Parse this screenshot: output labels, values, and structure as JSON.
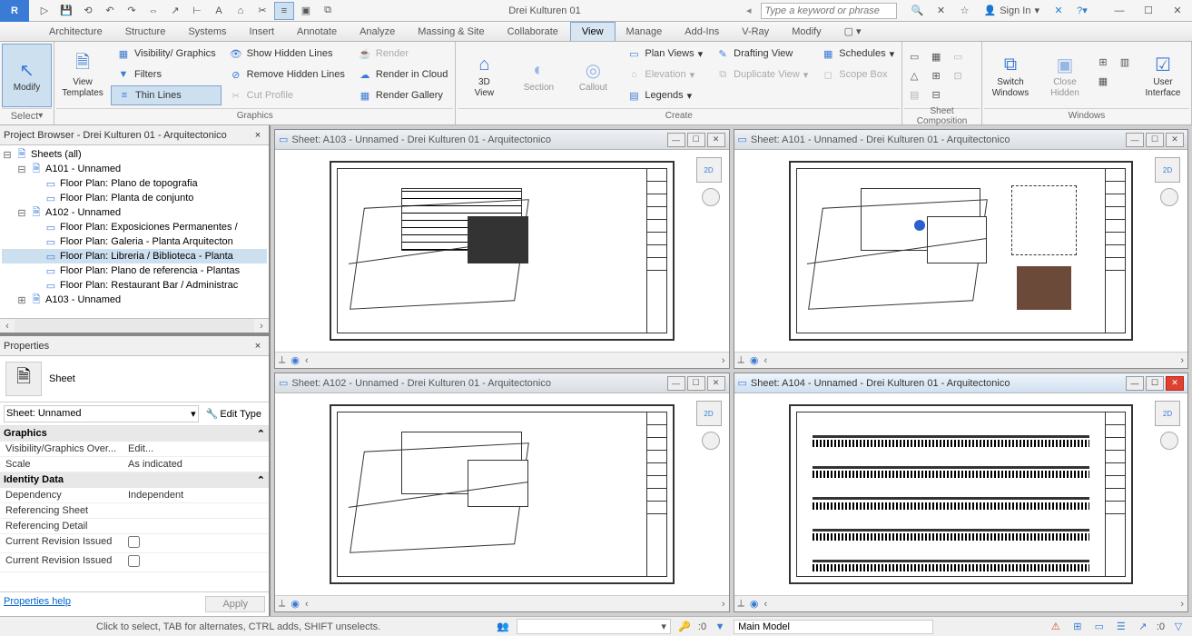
{
  "title": "Drei Kulturen 01",
  "search_placeholder": "Type a keyword or phrase",
  "sign_in": "Sign In",
  "tabs": [
    "Architecture",
    "Structure",
    "Systems",
    "Insert",
    "Annotate",
    "Analyze",
    "Massing & Site",
    "Collaborate",
    "View",
    "Manage",
    "Add-Ins",
    "V-Ray",
    "Modify"
  ],
  "active_tab": "View",
  "ribbon": {
    "select": "Select",
    "modify": "Modify",
    "view_templates": "View\nTemplates",
    "vis_graphics": "Visibility/ Graphics",
    "filters": "Filters",
    "thin_lines": "Thin Lines",
    "show_hidden": "Show Hidden Lines",
    "remove_hidden": "Remove Hidden Lines",
    "cut_profile": "Cut Profile",
    "render": "Render",
    "render_cloud": "Render in Cloud",
    "render_gallery": "Render Gallery",
    "view3d": "3D\nView",
    "section": "Section",
    "callout": "Callout",
    "plan_views": "Plan Views",
    "elevation": "Elevation",
    "drafting_view": "Drafting View",
    "duplicate_view": "Duplicate View",
    "legends": "Legends",
    "schedules": "Schedules",
    "scope_box": "Scope Box",
    "switch_windows": "Switch\nWindows",
    "close_hidden": "Close\nHidden",
    "user_interface": "User\nInterface",
    "panel_graphics": "Graphics",
    "panel_create": "Create",
    "panel_sheetcomp": "Sheet Composition",
    "panel_windows": "Windows"
  },
  "browser": {
    "title": "Project Browser - Drei Kulturen 01 - Arquitectonico",
    "root": "Sheets (all)",
    "sheets": [
      {
        "name": "A101 - Unnamed",
        "plans": [
          "Floor Plan: Plano de topografia",
          "Floor Plan: Planta de conjunto"
        ]
      },
      {
        "name": "A102 - Unnamed",
        "plans": [
          "Floor Plan: Exposiciones Permanentes / ",
          "Floor Plan: Galeria - Planta Arquitecton",
          "Floor Plan: Libreria / Biblioteca - Planta",
          "Floor Plan: Plano de referencia - Plantas",
          "Floor Plan: Restaurant Bar / Administrac"
        ]
      },
      {
        "name": "A103 - Unnamed",
        "plans": []
      }
    ],
    "selected": "Floor Plan: Libreria / Biblioteca - Planta"
  },
  "properties": {
    "title": "Properties",
    "type": "Sheet",
    "selector": "Sheet: Unnamed",
    "edit_type": "Edit Type",
    "groups": [
      {
        "name": "Graphics",
        "rows": [
          {
            "k": "Visibility/Graphics Over...",
            "v": "Edit..."
          },
          {
            "k": "Scale",
            "v": "As indicated"
          }
        ]
      },
      {
        "name": "Identity Data",
        "rows": [
          {
            "k": "Dependency",
            "v": "Independent"
          },
          {
            "k": "Referencing Sheet",
            "v": ""
          },
          {
            "k": "Referencing Detail",
            "v": ""
          },
          {
            "k": "Current Revision Issued",
            "v": ""
          },
          {
            "k": "Current Revision Issued",
            "v": ""
          }
        ]
      }
    ],
    "help": "Properties help",
    "apply": "Apply"
  },
  "views": [
    {
      "title": "Sheet: A103 - Unnamed - Drei Kulturen 01 - Arquitectonico",
      "active": false
    },
    {
      "title": "Sheet: A101 - Unnamed - Drei Kulturen 01 - Arquitectonico",
      "active": false
    },
    {
      "title": "Sheet: A102 - Unnamed - Drei Kulturen 01 - Arquitectonico",
      "active": false
    },
    {
      "title": "Sheet: A104 - Unnamed - Drei Kulturen 01 - Arquitectonico",
      "active": true
    }
  ],
  "status": {
    "hint": "Click to select, TAB for alternates, CTRL adds, SHIFT unselects.",
    "sel_count": ":0",
    "model": "Main Model"
  }
}
